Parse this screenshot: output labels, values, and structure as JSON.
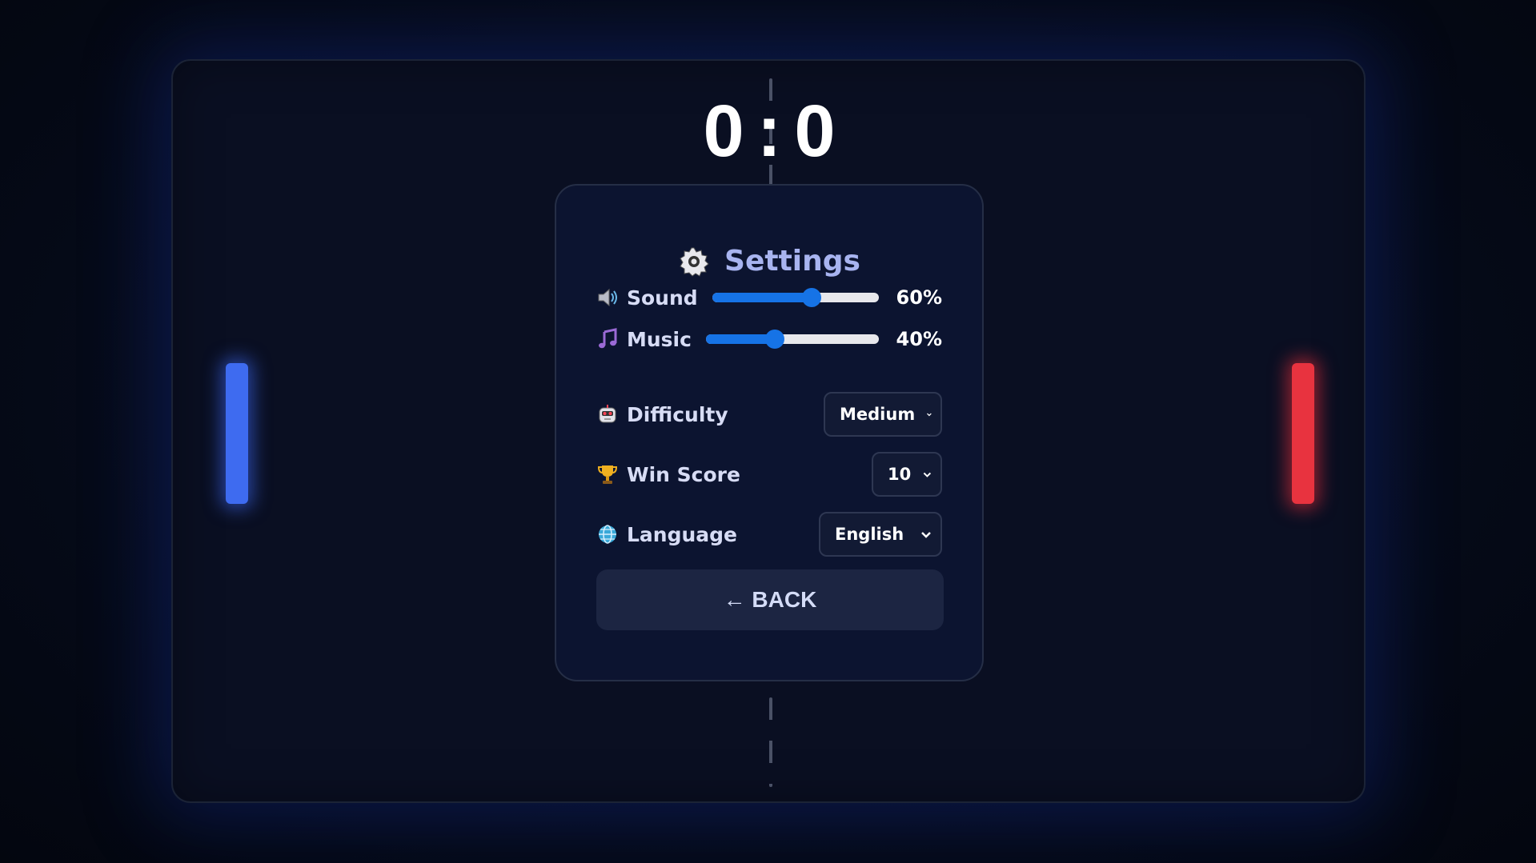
{
  "score": {
    "left": "0",
    "separator": ":",
    "right": "0"
  },
  "settings": {
    "title": "Settings",
    "title_icon": "gear-icon",
    "sound": {
      "label": "Sound",
      "value_text": "60%",
      "value": 0.6,
      "icon": "speaker-icon"
    },
    "music": {
      "label": "Music",
      "value_text": "40%",
      "value": 0.4,
      "icon": "music-note-icon"
    },
    "difficulty": {
      "label": "Difficulty",
      "selected": "Medium",
      "icon": "robot-icon"
    },
    "win_score": {
      "label": "Win Score",
      "selected": "10",
      "icon": "trophy-icon"
    },
    "language": {
      "label": "Language",
      "selected": "English",
      "icon": "globe-icon"
    },
    "back_label": "← BACK"
  },
  "colors": {
    "left_paddle": "#3e6bf0",
    "right_paddle": "#e8333f",
    "slider_accent": "#1673e6",
    "title": "#a8b4f0",
    "panel_bg": "#0c1430"
  }
}
